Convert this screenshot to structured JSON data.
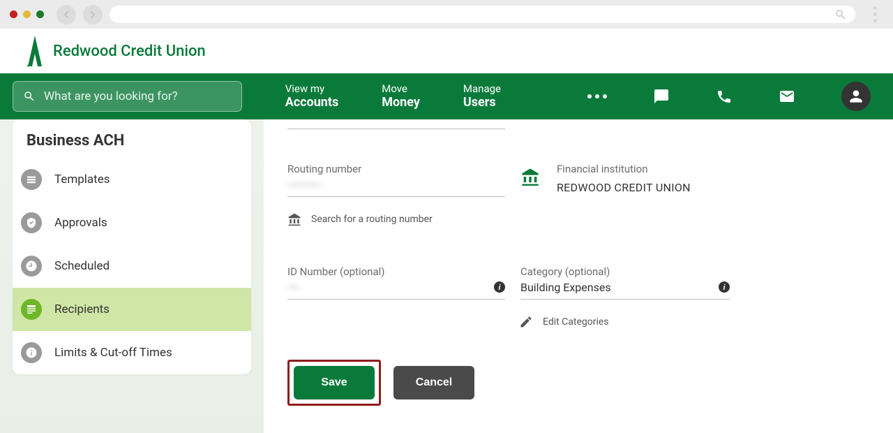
{
  "logo_text": "Redwood Credit Union",
  "search": {
    "placeholder": "What are you looking for?"
  },
  "nav": {
    "accounts": {
      "small": "View my",
      "big": "Accounts"
    },
    "money": {
      "small": "Move",
      "big": "Money"
    },
    "users": {
      "small": "Manage",
      "big": "Users"
    }
  },
  "sidebar": {
    "title": "Business ACH",
    "items": [
      {
        "label": "Templates"
      },
      {
        "label": "Approvals"
      },
      {
        "label": "Scheduled"
      },
      {
        "label": "Recipients"
      },
      {
        "label": "Limits & Cut-off Times"
      }
    ]
  },
  "form": {
    "routing_label": "Routing number",
    "routing_value": "•••••••••",
    "fi_label": "Financial institution",
    "fi_value": "REDWOOD CREDIT UNION",
    "search_routing": "Search for a routing number",
    "id_label": "ID Number (optional)",
    "id_value": "•••",
    "category_label": "Category (optional)",
    "category_value": "Building Expenses",
    "edit_categories": "Edit Categories",
    "save": "Save",
    "cancel": "Cancel"
  }
}
